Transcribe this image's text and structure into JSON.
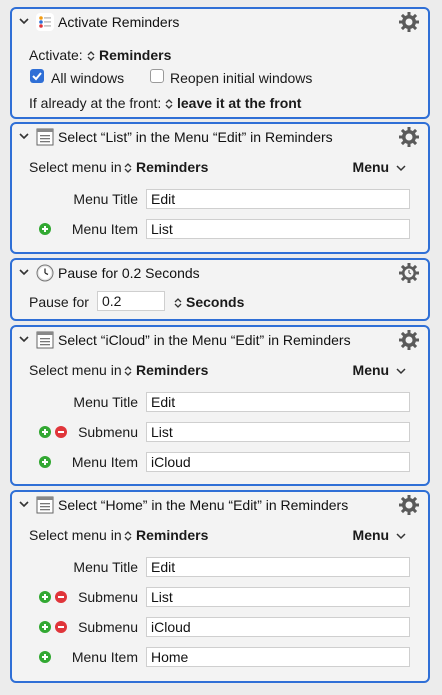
{
  "actions": [
    {
      "title": "Activate Reminders",
      "activate_label": "Activate:",
      "app": "Reminders",
      "all_windows": "All windows",
      "all_windows_checked": true,
      "reopen": "Reopen initial windows",
      "reopen_checked": false,
      "if_front_label": "If already at the front:",
      "if_front_value": "leave it at the front"
    },
    {
      "title": "Select “List” in the Menu “Edit” in Reminders",
      "select_menu_in": "Select menu in",
      "app": "Reminders",
      "menu_dropdown": "Menu",
      "menu_title_label": "Menu Title",
      "menu_title": "Edit",
      "menu_item_label": "Menu Item",
      "menu_item": "List"
    },
    {
      "title": "Pause for 0.2 Seconds",
      "pause_label": "Pause for",
      "pause_value": "0.2",
      "unit": "Seconds"
    },
    {
      "title": "Select “iCloud” in the Menu “Edit” in Reminders",
      "select_menu_in": "Select menu in",
      "app": "Reminders",
      "menu_dropdown": "Menu",
      "menu_title_label": "Menu Title",
      "menu_title": "Edit",
      "submenu_label": "Submenu",
      "submenu": "List",
      "menu_item_label": "Menu Item",
      "menu_item": "iCloud"
    },
    {
      "title": "Select “Home” in the Menu “Edit” in Reminders",
      "select_menu_in": "Select menu in",
      "app": "Reminders",
      "menu_dropdown": "Menu",
      "menu_title_label": "Menu Title",
      "menu_title": "Edit",
      "submenu_label": "Submenu",
      "submenu1": "List",
      "submenu2": "iCloud",
      "menu_item_label": "Menu Item",
      "menu_item": "Home"
    }
  ],
  "colors": {
    "accent": "#2f6fd6",
    "add": "#32a832",
    "remove": "#e0353a"
  },
  "icons": {
    "collapse": "chevron-down-icon",
    "gear": "gear-icon",
    "reminders": "reminders-app-icon",
    "menu": "menu-action-icon",
    "clock": "clock-icon",
    "updown": "updown-arrows-icon"
  }
}
